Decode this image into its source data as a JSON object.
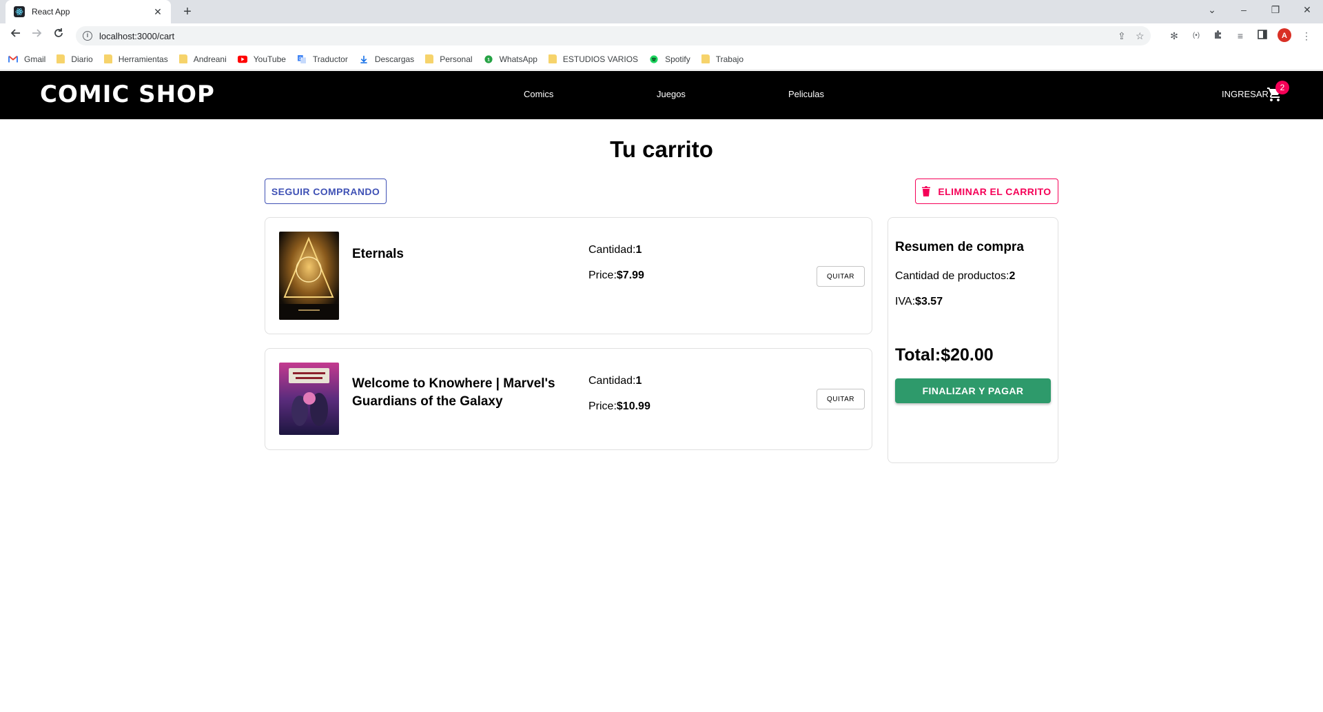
{
  "browser": {
    "tab_title": "React App",
    "tab_close": "✕",
    "new_tab": "+",
    "url": "localhost:3000/cart",
    "window_controls": {
      "dropdown": "⌄",
      "minimize": "–",
      "restore": "❐",
      "close": "✕"
    }
  },
  "bookmarks": [
    {
      "label": "Gmail",
      "icon": "gmail-icon"
    },
    {
      "label": "Diario",
      "icon": "folder-icon"
    },
    {
      "label": "Herramientas",
      "icon": "folder-icon"
    },
    {
      "label": "Andreani",
      "icon": "folder-icon"
    },
    {
      "label": "YouTube",
      "icon": "youtube-icon"
    },
    {
      "label": "Traductor",
      "icon": "translate-icon"
    },
    {
      "label": "Descargas",
      "icon": "download-icon"
    },
    {
      "label": "Personal",
      "icon": "folder-icon"
    },
    {
      "label": "WhatsApp",
      "icon": "whatsapp-icon"
    },
    {
      "label": "ESTUDIOS VARIOS",
      "icon": "folder-icon"
    },
    {
      "label": "Spotify",
      "icon": "spotify-icon"
    },
    {
      "label": "Trabajo",
      "icon": "folder-icon"
    }
  ],
  "header": {
    "logo": "COMIC SHOP",
    "nav": [
      "Comics",
      "Juegos",
      "Peliculas"
    ],
    "login": "INGRESAR",
    "cart_count": "2"
  },
  "page": {
    "title": "Tu carrito",
    "continue_button": "SEGUIR COMPRANDO",
    "clear_button": "ELIMINAR EL CARRITO"
  },
  "items": [
    {
      "title": "Eternals",
      "qty_label": "Cantidad:",
      "qty": "1",
      "price_label": "Price:",
      "price": "$7.99",
      "remove": "QUITAR"
    },
    {
      "title": "Welcome to Knowhere | Marvel's Guardians of the Galaxy",
      "qty_label": "Cantidad:",
      "qty": "1",
      "price_label": "Price:",
      "price": "$10.99",
      "remove": "QUITAR"
    }
  ],
  "summary": {
    "title": "Resumen de compra",
    "count_label": "Cantidad de productos:",
    "count": "2",
    "iva_label": "IVA:",
    "iva": "$3.57",
    "total_label": "Total:",
    "total": "$20.00",
    "pay_button": "FINALIZAR Y PAGAR"
  },
  "colors": {
    "primary": "#3f51b5",
    "secondary": "#f50057",
    "success": "#2e9a6b",
    "header_bg": "#000000"
  }
}
